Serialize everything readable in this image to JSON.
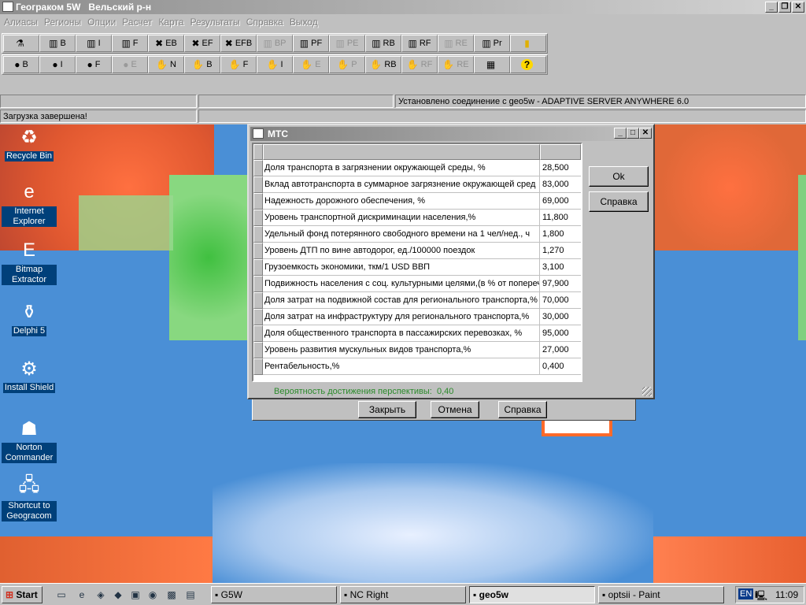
{
  "app": {
    "title": "Геограком 5W   Вельский р-н",
    "controls": {
      "minimize": "_",
      "restore": "❐",
      "close": "✕"
    }
  },
  "menu": [
    "Алиасы",
    "Регионы",
    "Опции",
    "Расчет",
    "Карта",
    "Результаты",
    "Справка",
    "Выход"
  ],
  "toolbar1": [
    {
      "icon": "run-icon",
      "glyph": "⚗",
      "label": "",
      "enabled": true
    },
    {
      "icon": "bars-icon",
      "glyph": "▥",
      "label": "B",
      "enabled": true
    },
    {
      "icon": "bars-icon",
      "glyph": "▥",
      "label": "I",
      "enabled": true
    },
    {
      "icon": "bars-icon",
      "glyph": "▥",
      "label": "F",
      "enabled": true
    },
    {
      "icon": "tools-icon",
      "glyph": "✖",
      "label": "EB",
      "enabled": true
    },
    {
      "icon": "tools-icon",
      "glyph": "✖",
      "label": "EF",
      "enabled": true
    },
    {
      "icon": "tools-icon",
      "glyph": "✖",
      "label": "EFB",
      "enabled": true
    },
    {
      "icon": "bars-icon",
      "glyph": "▥",
      "label": "BP",
      "enabled": false
    },
    {
      "icon": "bars-icon",
      "glyph": "▥",
      "label": "PF",
      "enabled": true
    },
    {
      "icon": "bars-icon",
      "glyph": "▥",
      "label": "PE",
      "enabled": false
    },
    {
      "icon": "bars-icon",
      "glyph": "▥",
      "label": "RB",
      "enabled": true
    },
    {
      "icon": "bars-icon",
      "glyph": "▥",
      "label": "RF",
      "enabled": true
    },
    {
      "icon": "bars-icon",
      "glyph": "▥",
      "label": "RE",
      "enabled": false
    },
    {
      "icon": "bars-icon",
      "glyph": "▥",
      "label": "Pr",
      "enabled": true
    },
    {
      "icon": "exit-door-icon",
      "glyph": "▮",
      "label": "",
      "enabled": true
    }
  ],
  "toolbar2": [
    {
      "icon": "globe-icon",
      "glyph": "●",
      "label": "B",
      "enabled": true
    },
    {
      "icon": "globe-icon",
      "glyph": "●",
      "label": "I",
      "enabled": true
    },
    {
      "icon": "globe-icon",
      "glyph": "●",
      "label": "F",
      "enabled": true
    },
    {
      "icon": "globe-icon",
      "glyph": "●",
      "label": "E",
      "enabled": false
    },
    {
      "icon": "hands-icon",
      "glyph": "✋",
      "label": "N",
      "enabled": true
    },
    {
      "icon": "hands-icon",
      "glyph": "✋",
      "label": "B",
      "enabled": true
    },
    {
      "icon": "hands-icon",
      "glyph": "✋",
      "label": "F",
      "enabled": true
    },
    {
      "icon": "hands-icon",
      "glyph": "✋",
      "label": "I",
      "enabled": true
    },
    {
      "icon": "hands-icon",
      "glyph": "✋",
      "label": "E",
      "enabled": false
    },
    {
      "icon": "hands-icon",
      "glyph": "✋",
      "label": "P",
      "enabled": false
    },
    {
      "icon": "hands-icon",
      "glyph": "✋",
      "label": "RB",
      "enabled": true
    },
    {
      "icon": "hands-icon",
      "glyph": "✋",
      "label": "RF",
      "enabled": false
    },
    {
      "icon": "hands-icon",
      "glyph": "✋",
      "label": "RE",
      "enabled": false
    },
    {
      "icon": "chart-icon",
      "glyph": "▦",
      "label": "",
      "enabled": true
    },
    {
      "icon": "help-icon",
      "glyph": "?",
      "label": "",
      "enabled": true
    }
  ],
  "status": {
    "connection": "Установлено соединение с geo5w - ADAPTIVE SERVER ANYWHERE 6.0",
    "load": "Загрузка завершена!"
  },
  "desktop_icons": [
    {
      "label": "Recycle Bin",
      "icon": "recycle-bin-icon",
      "glyph": "♻"
    },
    {
      "label": "Internet Explorer",
      "icon": "internet-explorer-icon",
      "glyph": "e"
    },
    {
      "label": "Bitmap Extractor",
      "icon": "bitmap-extractor-icon",
      "glyph": "E"
    },
    {
      "label": "Delphi 5",
      "icon": "delphi-icon",
      "glyph": "⚱"
    },
    {
      "label": "Install Shield",
      "icon": "install-shield-icon",
      "glyph": "⚙"
    },
    {
      "label": "Norton Commander",
      "icon": "norton-commander-icon",
      "glyph": "☗"
    },
    {
      "label": "Shortcut to Geogracom",
      "icon": "network-shortcut-icon",
      "glyph": "🖧"
    }
  ],
  "dialog": {
    "title": "МТС",
    "rows": [
      {
        "label": "Доля  транспорта в загрязнении окружающей среды, %",
        "value": "28,500"
      },
      {
        "label": "Вклад  автотранспорта в суммарное загрязнение окружающей сред",
        "value": "83,000"
      },
      {
        "label": "Надежность дорожного обеспечения,  %",
        "value": "69,000"
      },
      {
        "label": "Уровень транспортной дискриминации населения,%",
        "value": "11,800"
      },
      {
        "label": "Удельный фонд потерянного свободного времени на 1 чел/нед., ч",
        "value": "1,800"
      },
      {
        "label": "Уровень ДТП по вине автодорог, ед./100000 поездок",
        "value": "1,270"
      },
      {
        "label": "Грузоемкость экономики, ткм/1 USD  ВВП",
        "value": "3,100"
      },
      {
        "label": "Подвижность населения с соц. культурными целями,(в % от попереч",
        "value": "97,900"
      },
      {
        "label": "Доля затрат на подвижной состав для регионального транспорта,%",
        "value": "70,000"
      },
      {
        "label": "Доля затрат на инфраструктуру  для регионального транспорта,%",
        "value": "30,000"
      },
      {
        "label": "Доля общественного транспорта в пассажирских перевозках, %",
        "value": "95,000"
      },
      {
        "label": "Уровень развития мускульных видов транспорта,%",
        "value": "27,000"
      },
      {
        "label": "Рентабельность,%",
        "value": "0,400"
      }
    ],
    "ok": "Ok",
    "help": "Справка",
    "probability_label": "Вероятность достижения перспективы:",
    "probability_value": "0,40"
  },
  "back_dialog": {
    "close": "Закрыть",
    "cancel": "Отмена",
    "help": "Справка"
  },
  "taskbar": {
    "start": "Start",
    "tasks": [
      "G5W",
      "NC Right",
      "geo5w",
      "optsii - Paint"
    ],
    "active_task": "geo5w",
    "lang": "EN",
    "clock": "11:09"
  },
  "colors": {
    "desktop": "#4a8fd6",
    "probability": "#2a8a2a",
    "icon_label_bg": "#00407a"
  }
}
